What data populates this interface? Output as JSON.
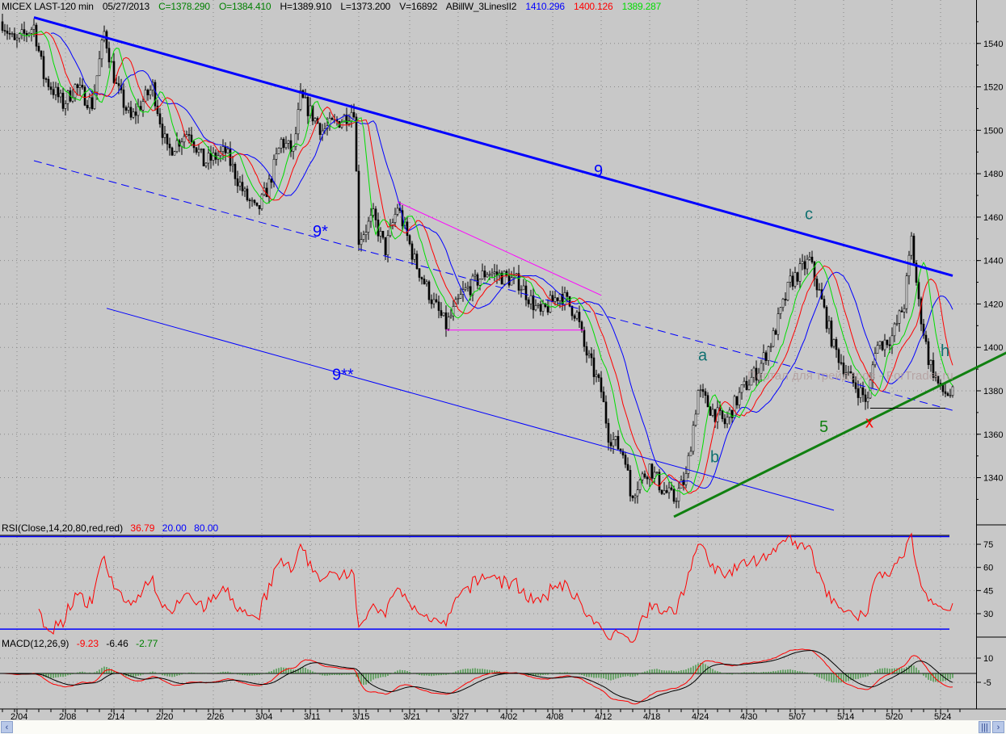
{
  "header": {
    "symbol": "MICEX LAST-120 min",
    "date": "05/27/2013",
    "close": "C=1378.290",
    "open": "O=1384.410",
    "high": "H=1389.910",
    "low": "L=1373.200",
    "volume": "V=16892",
    "indicator": "ABillW_3LinesII2",
    "ma_blue": "1410.296",
    "ma_red": "1400.126",
    "ma_green": "1389.287"
  },
  "rsi_label": {
    "name": "RSI(Close,14,20,80,red,red)",
    "value": "36.79",
    "low": "20.00",
    "high": "80.00"
  },
  "macd_label": {
    "name": "MACD(12,26,9)",
    "macd": "-9.23",
    "signal": "-6.46",
    "hist": "-2.77"
  },
  "watermark": "Портал для трейдеров - ForTrader.ru",
  "colors": {
    "bg": "#c8c8c8",
    "blue": "#0000ff",
    "red": "#ff0000",
    "green": "#00cc00",
    "dark_green": "#108010",
    "magenta": "#ff00ff",
    "teal": "#107070"
  },
  "chart_data": {
    "type": "candlestick",
    "price_axis": {
      "ylim": [
        1319,
        1560
      ],
      "ticks": [
        1340,
        1360,
        1380,
        1400,
        1420,
        1440,
        1460,
        1480,
        1500,
        1520,
        1540
      ]
    },
    "rsi_axis": {
      "ylim": [
        15,
        85
      ],
      "ticks": [
        30,
        45,
        60,
        75
      ],
      "levels": [
        20,
        80
      ]
    },
    "macd_axis": {
      "ticks": [
        10,
        -5
      ]
    },
    "x_ticks": [
      {
        "bar": 6,
        "label": "2/04"
      },
      {
        "bar": 26,
        "label": "2/08"
      },
      {
        "bar": 46,
        "label": "2/14"
      },
      {
        "bar": 66,
        "label": "2/20"
      },
      {
        "bar": 87,
        "label": "2/26"
      },
      {
        "bar": 107,
        "label": "3/04"
      },
      {
        "bar": 127,
        "label": "3/11"
      },
      {
        "bar": 147,
        "label": "3/15"
      },
      {
        "bar": 168,
        "label": "3/21"
      },
      {
        "bar": 188,
        "label": "3/27"
      },
      {
        "bar": 208,
        "label": "4/02"
      },
      {
        "bar": 227,
        "label": "4/08"
      },
      {
        "bar": 247,
        "label": "4/12"
      },
      {
        "bar": 267,
        "label": "4/18"
      },
      {
        "bar": 287,
        "label": "4/24"
      },
      {
        "bar": 307,
        "label": "4/30"
      },
      {
        "bar": 327,
        "label": "5/07"
      },
      {
        "bar": 347,
        "label": "5/14"
      },
      {
        "bar": 367,
        "label": "5/20"
      },
      {
        "bar": 387,
        "label": "5/24"
      }
    ],
    "price_path": [
      [
        0,
        1550
      ],
      [
        5,
        1540
      ],
      [
        13,
        1548
      ],
      [
        17,
        1525
      ],
      [
        25,
        1512
      ],
      [
        30,
        1520
      ],
      [
        37,
        1512
      ],
      [
        42,
        1545
      ],
      [
        47,
        1520
      ],
      [
        53,
        1505
      ],
      [
        62,
        1520
      ],
      [
        68,
        1490
      ],
      [
        77,
        1500
      ],
      [
        83,
        1485
      ],
      [
        92,
        1490
      ],
      [
        100,
        1470
      ],
      [
        105,
        1462
      ],
      [
        110,
        1475
      ],
      [
        115,
        1495
      ],
      [
        120,
        1490
      ],
      [
        123,
        1515
      ],
      [
        132,
        1500
      ],
      [
        140,
        1505
      ],
      [
        145,
        1510
      ],
      [
        147,
        1450
      ],
      [
        153,
        1460
      ],
      [
        158,
        1445
      ],
      [
        163,
        1465
      ],
      [
        170,
        1440
      ],
      [
        178,
        1420
      ],
      [
        183,
        1410
      ],
      [
        190,
        1425
      ],
      [
        200,
        1435
      ],
      [
        213,
        1430
      ],
      [
        222,
        1415
      ],
      [
        230,
        1425
      ],
      [
        237,
        1415
      ],
      [
        240,
        1400
      ],
      [
        247,
        1380
      ],
      [
        250,
        1360
      ],
      [
        257,
        1350
      ],
      [
        259,
        1332
      ],
      [
        267,
        1345
      ],
      [
        272,
        1335
      ],
      [
        277,
        1330
      ],
      [
        282,
        1340
      ],
      [
        287,
        1380
      ],
      [
        292,
        1372
      ],
      [
        298,
        1365
      ],
      [
        305,
        1380
      ],
      [
        312,
        1390
      ],
      [
        318,
        1405
      ],
      [
        325,
        1430
      ],
      [
        333,
        1440
      ],
      [
        337,
        1425
      ],
      [
        343,
        1400
      ],
      [
        350,
        1385
      ],
      [
        357,
        1375
      ],
      [
        360,
        1400
      ],
      [
        367,
        1405
      ],
      [
        372,
        1420
      ],
      [
        375,
        1450
      ],
      [
        378,
        1420
      ],
      [
        382,
        1395
      ],
      [
        387,
        1380
      ],
      [
        392,
        1378
      ]
    ],
    "trendlines": [
      {
        "name": "9",
        "color": "#0000ff",
        "width": 3,
        "dash": false,
        "from": [
          13,
          1552
        ],
        "to": [
          392,
          1433
        ]
      },
      {
        "name": "9*",
        "color": "#0000ff",
        "width": 1,
        "dash": true,
        "from": [
          13,
          1486
        ],
        "to": [
          392,
          1371
        ]
      },
      {
        "name": "9**",
        "color": "#0000ff",
        "width": 1,
        "dash": false,
        "from": [
          43,
          1418
        ],
        "to": [
          343,
          1325
        ]
      },
      {
        "name": "5",
        "color": "#108010",
        "width": 3,
        "dash": false,
        "from": [
          277,
          1322
        ],
        "to": [
          415,
          1398
        ]
      },
      {
        "name": "wedge-top",
        "color": "#ff00ff",
        "width": 1,
        "dash": false,
        "from": [
          163,
          1467
        ],
        "to": [
          247,
          1424
        ]
      },
      {
        "name": "wedge-bottom",
        "color": "#ff00ff",
        "width": 1,
        "dash": false,
        "from": [
          183,
          1408
        ],
        "to": [
          240,
          1408
        ]
      },
      {
        "name": "support",
        "color": "#000000",
        "width": 1,
        "dash": false,
        "from": [
          358,
          1372
        ],
        "to": [
          389,
          1372
        ]
      }
    ],
    "annotations": [
      {
        "text": "9",
        "color": "#0000ff",
        "bar": 244,
        "price": 1479
      },
      {
        "text": "9*",
        "color": "#0000ff",
        "bar": 128,
        "price": 1451
      },
      {
        "text": "9**",
        "color": "#0000ff",
        "bar": 136,
        "price": 1385
      },
      {
        "text": "c",
        "color": "#107070",
        "bar": 331,
        "price": 1459
      },
      {
        "text": "a",
        "color": "#107070",
        "bar": 287,
        "price": 1394
      },
      {
        "text": "b",
        "color": "#107070",
        "bar": 292,
        "price": 1347
      },
      {
        "text": "5",
        "color": "#108010",
        "bar": 337,
        "price": 1361
      },
      {
        "text": "x",
        "color": "#ff0000",
        "bar": 356,
        "price": 1363
      },
      {
        "text": "h",
        "color": "#107070",
        "bar": 387,
        "price": 1396
      }
    ]
  }
}
